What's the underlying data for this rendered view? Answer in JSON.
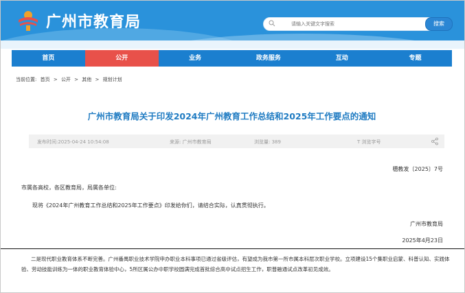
{
  "site": {
    "title": "广州市教育局"
  },
  "search": {
    "placeholder": "请输入关键文字搜索",
    "button_label": "搜索"
  },
  "nav": [
    "首页",
    "公开",
    "业务",
    "政务服务",
    "互动",
    "专题"
  ],
  "nav_active": "公开",
  "breadcrumb": {
    "prefix": "当前位置:",
    "items": [
      "首页",
      "公开",
      "其他",
      "规划计划"
    ],
    "separator": ">"
  },
  "article": {
    "title": "广州市教育局关于印发2024年广州教育工作总结和2025年工作要点的通知",
    "publish_time": "发布时间:2025-04-24 10:54:08",
    "source": "来源: 广州市教育局",
    "views": "浏览量: 389",
    "font_size_label": "T 浏览字号",
    "doc_number": "穗教发〔2025〕7号",
    "salutation": "市属各高校，各区教育局，局属各单位:",
    "body": "现将《2024年广州教育工作总结和2025年工作要点》印发给你们，请结合实际，认真贯彻执行。",
    "signature": "广州市教育局",
    "date": "2025年4月23日"
  },
  "excerpt": "二是现代职业教育体系不断完善。广州番禺职业技术学院申办职业本科事项已通过省级评估，有望成为我市第一所市属本科层次职业学校。立项建设15个集职业启蒙、科普认知、实践体验、劳动技能训练为一体的职业教育体验中心，5所区属公办中职学校圆满完成首批综合高中试点招生工作，职普融通试点改革初见成效。",
  "colors": {
    "header_blue": "#2a92db",
    "nav_blue": "#1b7fcf",
    "nav_active_red": "#e8514a",
    "title_blue": "#1f7bc2"
  }
}
